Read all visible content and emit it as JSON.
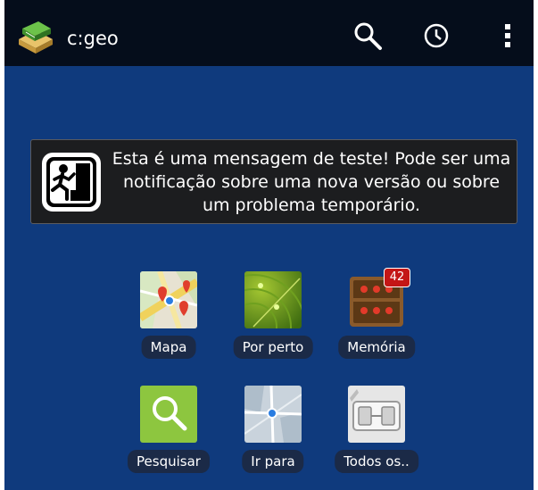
{
  "app": {
    "title": "c:geo",
    "logo_icon": "book-box-icon",
    "actions": [
      {
        "icon": "search-icon"
      },
      {
        "icon": "history-clock-icon"
      },
      {
        "icon": "overflow-menu-icon"
      }
    ]
  },
  "notice": {
    "icon": "climber-icon",
    "text": "Esta é uma mensagem de teste! Pode ser uma notificação sobre uma nova versão ou sobre um problema temporário."
  },
  "tiles": [
    {
      "label": "Mapa",
      "icon": "map-icon"
    },
    {
      "label": "Por perto",
      "icon": "radar-icon"
    },
    {
      "label": "Memória",
      "icon": "stored-caches-icon",
      "badge": "42"
    },
    {
      "label": "Pesquisar",
      "icon": "magnifier-icon"
    },
    {
      "label": "Ir para",
      "icon": "go-to-map-icon"
    },
    {
      "label": "Todos os..",
      "icon": "all-caches-icon"
    }
  ],
  "colors": {
    "appbar": "#050d1b",
    "background": "#0f3a7d",
    "notice_background": "#1c1d1f",
    "badge": "#c41616"
  }
}
